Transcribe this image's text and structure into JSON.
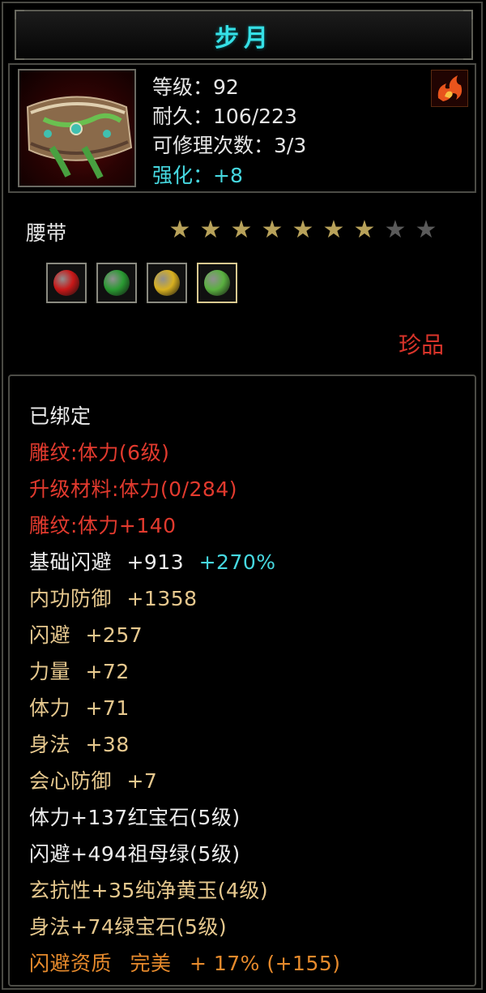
{
  "title": "步月",
  "item": {
    "icon": "belt-icon",
    "level_label": "等级：",
    "level_value": "92",
    "durability_label": "耐久：",
    "durability_value": "106/223",
    "repair_label": "可修理次数：",
    "repair_value": "3/3",
    "enhance_label": "强化：",
    "enhance_value": "+8",
    "badge_icon": "fire-emblem-icon"
  },
  "slot": "腰带",
  "stars": {
    "filled": 7,
    "total": 9,
    "filled_color": "#b8a25a",
    "empty_color": "#5a5a5a"
  },
  "gems": [
    {
      "icon": "ruby-gem-icon",
      "color": "#c81818"
    },
    {
      "icon": "emerald-gem-icon",
      "color": "#2a9a32"
    },
    {
      "icon": "yellow-jade-gem-icon",
      "color": "#d8b020"
    },
    {
      "icon": "green-gem-icon",
      "color": "#5ab040"
    }
  ],
  "rarity": "珍品",
  "stats": {
    "bound": "已绑定",
    "engrave_level": "雕纹:体力(6级)",
    "upgrade_material": "升级材料:体力(0/284)",
    "engrave_bonus": "雕纹:体力+140",
    "base_dodge_label": "基础闪避",
    "base_dodge_value": "+913",
    "base_dodge_pct": "+270%",
    "inner_defense_label": "内功防御",
    "inner_defense_value": "+1358",
    "dodge_label": "闪避",
    "dodge_value": "+257",
    "strength_label": "力量",
    "strength_value": "+72",
    "stamina_label": "体力",
    "stamina_value": "+71",
    "agility_label": "身法",
    "agility_value": "+38",
    "crit_defense_label": "会心防御",
    "crit_defense_value": "+7",
    "gem1": "体力+137红宝石(5级)",
    "gem2": "闪避+494祖母绿(5级)",
    "gem3": "玄抗性+35纯净黄玉(4级)",
    "gem4": "身法+74绿宝石(5级)",
    "quality_label": "闪避资质",
    "quality_grade": "完美",
    "quality_value": "+ 17% (+155)"
  },
  "colors": {
    "title": "#35e0e6",
    "red": "#e23a2e",
    "tan": "#e6c88e",
    "cyan": "#46d8e0",
    "orange": "#e68a2c"
  }
}
